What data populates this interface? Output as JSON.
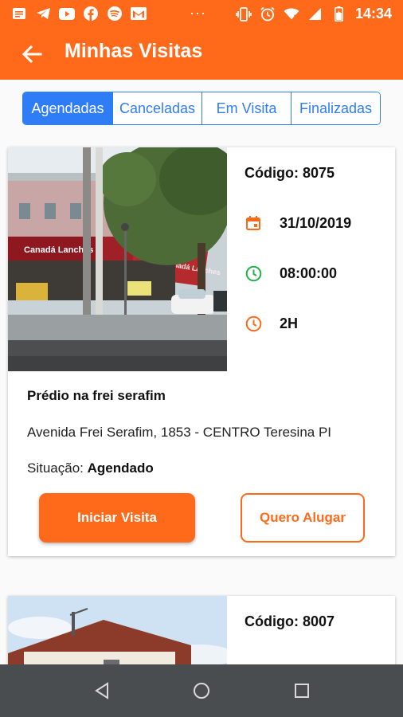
{
  "status_bar": {
    "time": "14:34",
    "dots": "···",
    "left_icons": [
      "message-icon",
      "telegram-icon",
      "youtube-icon",
      "facebook-icon",
      "spotify-icon",
      "gmail-icon"
    ],
    "right_icons": [
      "vibrate-icon",
      "alarm-icon",
      "wifi-icon",
      "signal-icon",
      "battery-icon"
    ]
  },
  "app_bar": {
    "title": "Minhas Visitas",
    "back_icon": "arrow-left-icon"
  },
  "tabs": [
    {
      "label": "Agendadas",
      "active": true
    },
    {
      "label": "Canceladas",
      "active": false
    },
    {
      "label": "Em Visita",
      "active": false
    },
    {
      "label": "Finalizadas",
      "active": false
    }
  ],
  "visits": [
    {
      "code": "Código: 8075",
      "date": "31/10/2019",
      "time": "08:00:00",
      "duration": "2H",
      "name": "Prédio na frei serafim",
      "address": "Avenida Frei Serafim, 1853 -  CENTRO Teresina PI",
      "status_label": "Situação:",
      "status_value": "Agendado",
      "photo_sign": "Canadá Lanches",
      "photo_sign_2": "Canadá Lanches",
      "start_button": "Iniciar Visita",
      "rent_button": "Quero Alugar"
    },
    {
      "code": "Código: 8007"
    }
  ],
  "colors": {
    "primary": "#ff6a1a",
    "tab_blue": "#2f7df6",
    "calendar_icon": "#ff6a1a",
    "time_icon": "#22b14c",
    "duration_icon": "#ff6a1a",
    "nav_bar": "#4a4d50"
  },
  "nav": {
    "back_icon": "nav-back-icon",
    "home_icon": "nav-home-icon",
    "recents_icon": "nav-recents-icon"
  }
}
